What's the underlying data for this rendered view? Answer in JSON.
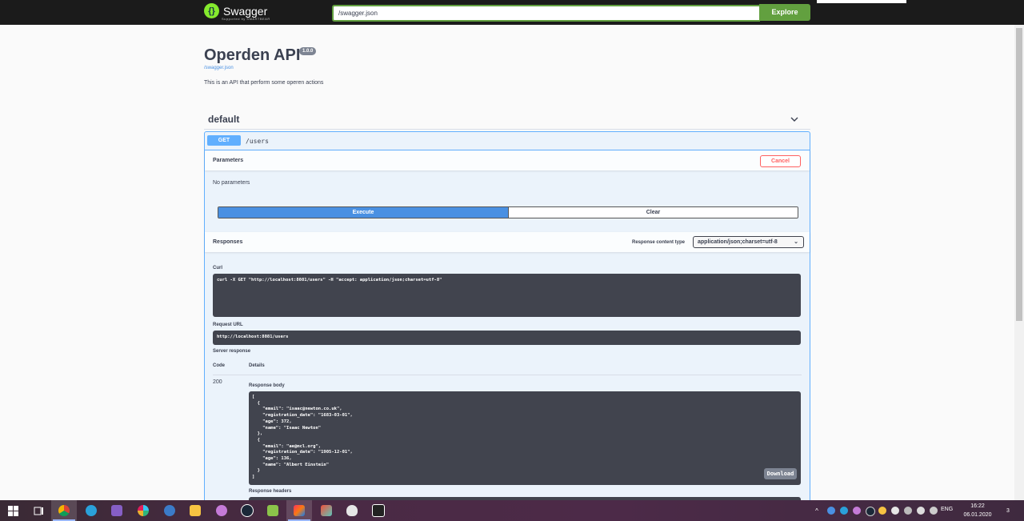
{
  "topbar": {
    "logo_text": "Swagger",
    "logo_sub": "Supported by SMARTBEAR",
    "url_value": "/swagger.json",
    "explore_label": "Explore"
  },
  "info": {
    "title": "Operden API",
    "version": "1.0.0",
    "spec_link": "/swagger.json",
    "description": "This is an API that perform some operen actions"
  },
  "tag": {
    "name": "default"
  },
  "operation": {
    "method": "GET",
    "path": "/users",
    "parameters_label": "Parameters",
    "cancel_label": "Cancel",
    "no_parameters": "No parameters",
    "execute_label": "Execute",
    "clear_label": "Clear",
    "responses_label": "Responses",
    "content_type_label": "Response content type",
    "content_type_value": "application/json;charset=utf-8",
    "curl_label": "Curl",
    "curl_command": "curl -X GET \"http://localhost:8081/users\" -H \"accept: application/json;charset=utf-8\"",
    "request_url_label": "Request URL",
    "request_url": "http://localhost:8081/users",
    "server_response_label": "Server response",
    "code_header": "Code",
    "details_header": "Details",
    "status_code": "200",
    "response_body_label": "Response body",
    "response_body": "[\n  {\n    \"email\": \"isaac@newton.co.uk\",\n    \"registration_date\": \"1683-03-01\",\n    \"age\": 372,\n    \"name\": \"Isaac Newton\"\n  },\n  {\n    \"email\": \"ae@mcl.org\",\n    \"registration_date\": \"1905-12-01\",\n    \"age\": 136,\n    \"name\": \"Albert Einstein\"\n  }\n]",
    "download_label": "Download",
    "response_headers_label": "Response headers"
  },
  "taskbar": {
    "language": "ENG",
    "time": "16:22",
    "date": "06.01.2020",
    "notification_count": "3",
    "apps": [
      "windows-start-icon",
      "task-view-icon",
      "chrome-icon",
      "telegram-icon",
      "visual-studio-icon",
      "slack-icon",
      "qbittorrent-icon",
      "file-explorer-icon",
      "app-icon",
      "steam-icon",
      "notepad-plus-plus-icon",
      "intellij-icon",
      "git-kraken-icon",
      "alienware-icon",
      "7zip-icon"
    ]
  }
}
